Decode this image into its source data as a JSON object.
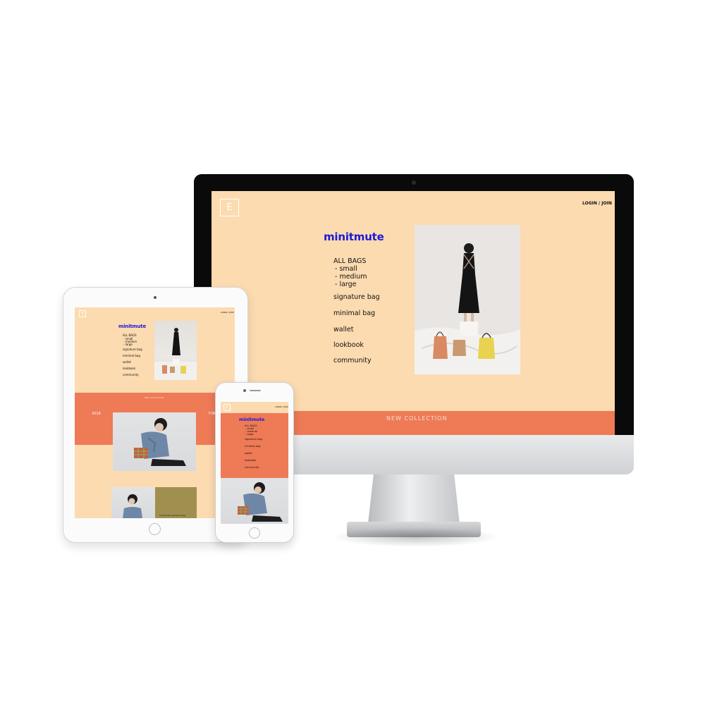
{
  "site": {
    "brand": "minitmute",
    "logo_letter": "E",
    "login_join": "LOGIN / JOIN",
    "nav": {
      "all_bags": "ALL BAGS",
      "sub": [
        "- small",
        "- medium",
        "- large"
      ],
      "items": [
        "signature bag",
        "minimal bag",
        "wallet",
        "lookbook",
        "community"
      ]
    },
    "new_collection": "NEW COLLECTION",
    "year": "2018",
    "season": "F/W",
    "caption": "minitmute signature bag"
  },
  "colors": {
    "background": "#fcdbb0",
    "accent": "#ee7a56",
    "brand": "#1b1bd8",
    "olive": "#a0904f"
  },
  "icons": [
    "camera-icon",
    "home-button-icon",
    "speaker-icon"
  ]
}
